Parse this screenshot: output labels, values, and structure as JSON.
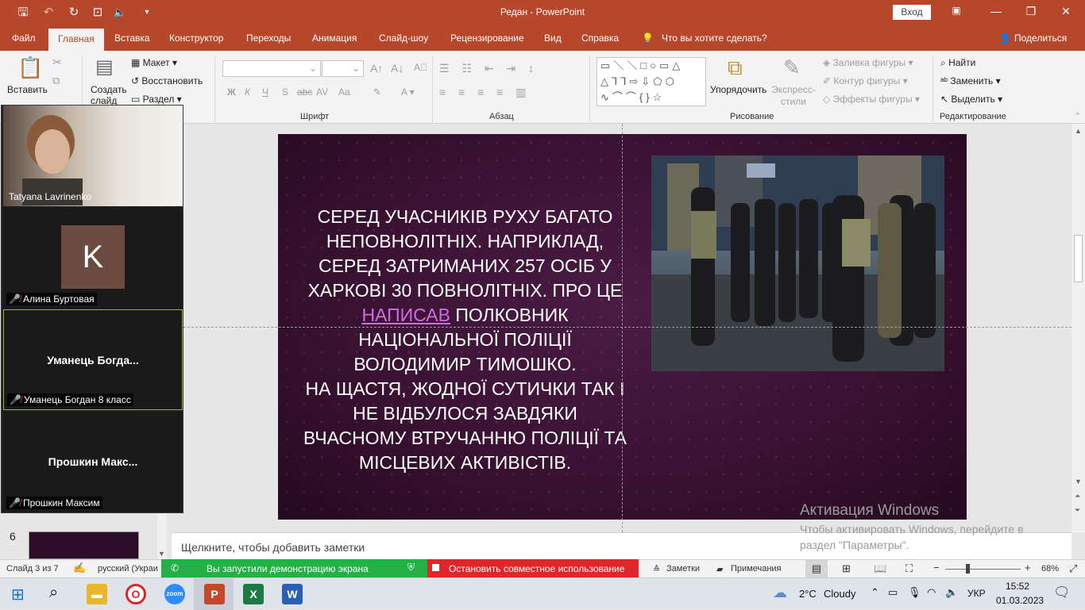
{
  "app": {
    "title": "Редан  -  PowerPoint",
    "login": "Вход"
  },
  "tabs": [
    "Файл",
    "Главная",
    "Вставка",
    "Конструктор",
    "Переходы",
    "Анимация",
    "Слайд-шоу",
    "Рецензирование",
    "Вид",
    "Справка",
    "Что вы хотите сделать?",
    "Поделиться"
  ],
  "ribbon": {
    "clipboard": {
      "paste": "Вставить"
    },
    "slides": {
      "new_slide": "Создать слайд",
      "layout": "Макет",
      "reset": "Восстановить",
      "section": "Раздел"
    },
    "font": {
      "label": "Шрифт",
      "bold": "Ж",
      "italic": "К",
      "underline": "Ч",
      "strike": "S",
      "abc": "abc",
      "spacing": "AV",
      "case": "Aa"
    },
    "paragraph": {
      "label": "Абзац"
    },
    "drawing": {
      "label": "Рисование",
      "arrange": "Упорядочить",
      "styles": "Экспресс-стили",
      "fill": "Заливка фигуры",
      "outline": "Контур фигуры",
      "effects": "Эффекты фигуры"
    },
    "editing": {
      "label": "Редактирование",
      "find": "Найти",
      "replace": "Заменить",
      "select": "Выделить"
    }
  },
  "slide": {
    "text_before": "Серед учасників руху багато неповнолітніх. Наприклад, серед затриманих 257 осіб у Харкові 30 повнолітніх. Про це",
    "link": "написав",
    "text_after": "полковник Національної поліції Володимир Тимошко.",
    "text2": "На щастя, жодної сутички так і не відбулося завдяки вчасному втручанню поліції та місцевих активістів."
  },
  "notes": {
    "placeholder": "Щелкните, чтобы добавить заметки"
  },
  "activation": {
    "title": "Активация Windows",
    "text": "Чтобы активировать Windows, перейдите в раздел \"Параметры\"."
  },
  "thumbnails": {
    "visible_number": "6"
  },
  "zoom": {
    "participants": [
      {
        "name": "Tatyana Lavrinenko",
        "type": "video"
      },
      {
        "name": "Алина Буртовая",
        "type": "avatar",
        "initial": "K"
      },
      {
        "name": "Уманець Богдан 8 класс",
        "display": "Уманець  Богда...",
        "type": "name"
      },
      {
        "name": "Прошкин Максим",
        "display": "Прошкин  Макс...",
        "type": "name"
      }
    ],
    "share_status": "Вы запустили демонстрацию экрана",
    "stop_share": "Остановить совместное использование"
  },
  "status": {
    "slide": "Слайд 3 из 7",
    "language": "русский (Украи",
    "notes": "Заметки",
    "comments": "Примечания",
    "zoom": "68%"
  },
  "taskbar": {
    "weather_temp": "2°C",
    "weather_text": "Cloudy",
    "lang": "УКР",
    "time": "15:52",
    "date": "01.03.2023"
  },
  "colors": {
    "accent": "#b7472a",
    "zoom_green": "#24b047",
    "zoom_red": "#e0262a"
  }
}
